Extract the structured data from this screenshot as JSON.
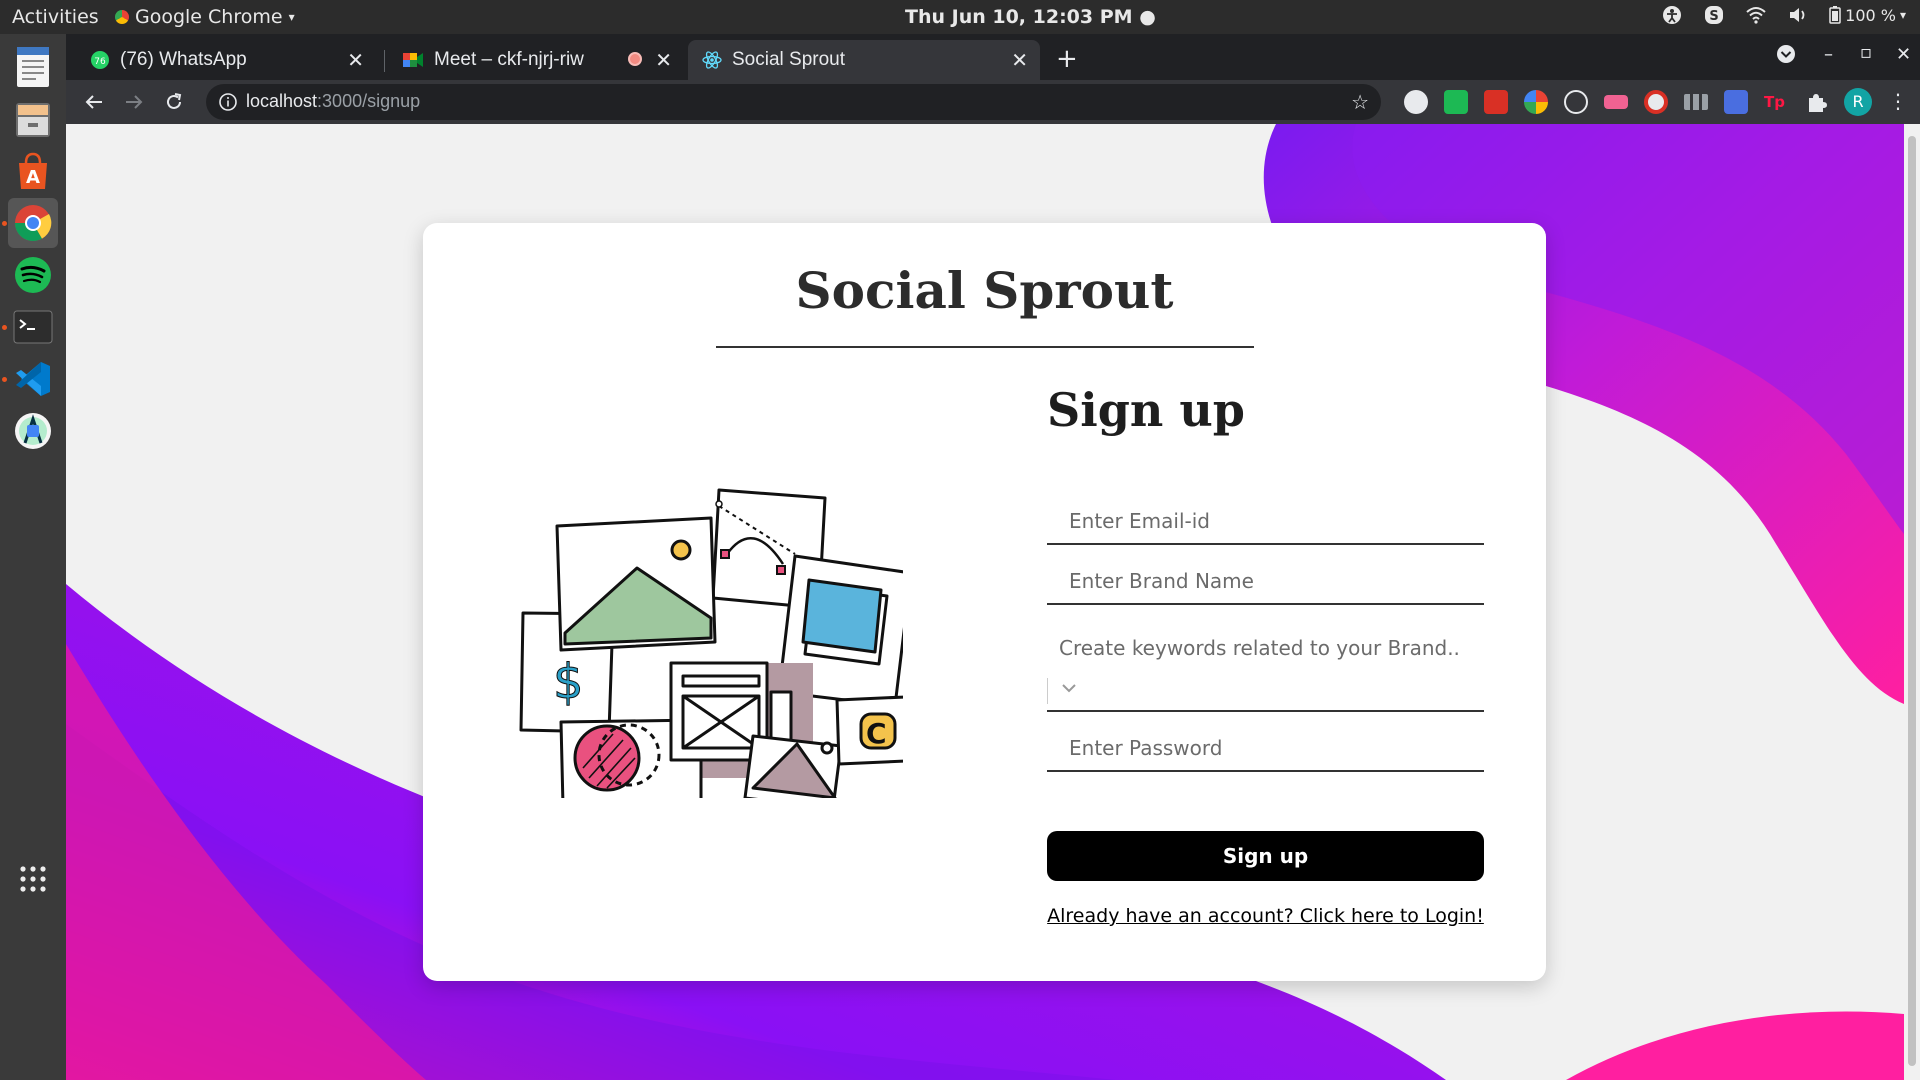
{
  "os": {
    "activities": "Activities",
    "app_menu": "Google Chrome",
    "clock": "Thu Jun 10, 12:03 PM",
    "battery": "100 %"
  },
  "dock": {
    "items": [
      "text-editor",
      "files",
      "software-center",
      "chrome",
      "spotify",
      "terminal",
      "vscode",
      "android-studio",
      "show-apps"
    ]
  },
  "browser": {
    "tabs": [
      {
        "title": "(76) WhatsApp",
        "badge": "76"
      },
      {
        "title": "Meet – ckf-njrj-riw"
      },
      {
        "title": "Social Sprout"
      }
    ],
    "url_host": "localhost",
    "url_path": ":3000/signup",
    "profile_initial": "R"
  },
  "page": {
    "brand": "Social Sprout",
    "heading": "Sign up",
    "email_placeholder": "Enter Email-id",
    "brand_placeholder": "Enter Brand Name",
    "keywords_label": "Create keywords related to your Brand..",
    "password_placeholder": "Enter Password",
    "submit_label": "Sign up",
    "login_link": "Already have an account? Click here to Login!"
  },
  "colors": {
    "accent_purple": "#8a10f0",
    "accent_pink": "#ff1493",
    "button": "#000000"
  }
}
